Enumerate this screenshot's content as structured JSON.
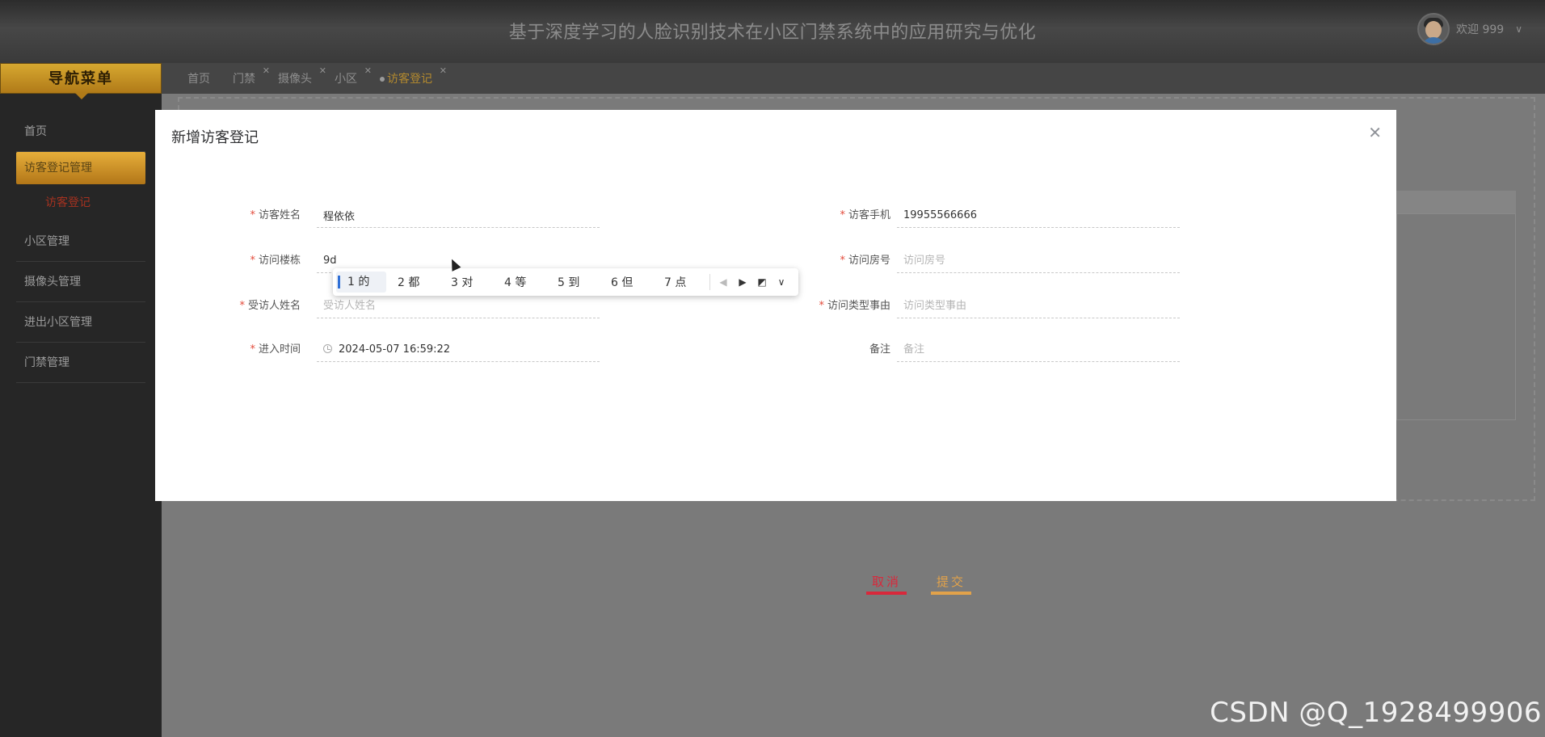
{
  "header": {
    "title": "基于深度学习的人脸识别技术在小区门禁系统中的应用研究与优化",
    "welcome": "欢迎 999",
    "avatar_icon": "user-avatar"
  },
  "sidebar": {
    "title": "导航菜单",
    "items": [
      {
        "label": "首页"
      },
      {
        "label": "访客登记管理"
      },
      {
        "label": "访客登记"
      },
      {
        "label": "小区管理"
      },
      {
        "label": "摄像头管理"
      },
      {
        "label": "进出小区管理"
      },
      {
        "label": "门禁管理"
      }
    ]
  },
  "tabs": [
    {
      "label": "首页"
    },
    {
      "label": "门禁"
    },
    {
      "label": "摄像头"
    },
    {
      "label": "小区"
    },
    {
      "label": "访客登记"
    }
  ],
  "modal": {
    "title": "新增访客登记",
    "fields": {
      "visitor_name": {
        "label": "访客姓名",
        "value": "程依依",
        "placeholder": ""
      },
      "visitor_phone": {
        "label": "访客手机",
        "value": "19955566666",
        "placeholder": ""
      },
      "building": {
        "label": "访问楼栋",
        "value": "9d",
        "placeholder": ""
      },
      "room": {
        "label": "访问房号",
        "value": "",
        "placeholder": "访问房号"
      },
      "host_name": {
        "label": "受访人姓名",
        "value": "",
        "placeholder": "受访人姓名"
      },
      "reason": {
        "label": "访问类型事由",
        "value": "",
        "placeholder": "访问类型事由"
      },
      "entry_time": {
        "label": "进入时间",
        "value": "2024-05-07 16:59:22"
      },
      "remark": {
        "label": "备注",
        "value": "",
        "placeholder": "备注"
      }
    },
    "cancel_label": "取消",
    "submit_label": "提交"
  },
  "ime": {
    "candidates": [
      "1 的",
      "2 都",
      "3 对",
      "4 等",
      "5 到",
      "6 但",
      "7 点"
    ]
  },
  "watermark": "CSDN @Q_1928499906",
  "colors": {
    "accent": "#d7a830",
    "danger": "#d9283b",
    "submit": "#e2a24a",
    "required": "#e34a3a"
  }
}
